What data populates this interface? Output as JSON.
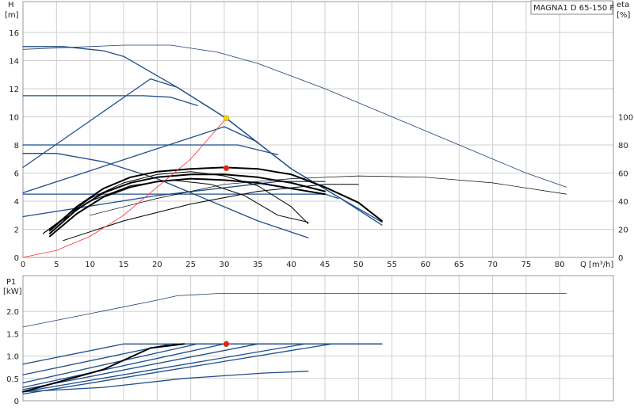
{
  "model_label": "MAGNA1 D 65-150 F",
  "chart_data": [
    {
      "type": "line",
      "name": "head",
      "ylabel": "H",
      "yunit": "[m]",
      "y2label": "eta",
      "y2unit": "[%]",
      "xlabel": "Q [m³/h]",
      "xlim": [
        0,
        88
      ],
      "ylim": [
        0,
        18.2
      ],
      "y2lim": [
        0,
        182
      ],
      "grid": true,
      "x_ticks": [
        0,
        5,
        10,
        15,
        20,
        25,
        30,
        35,
        40,
        45,
        50,
        55,
        60,
        65,
        70,
        75,
        80
      ],
      "y_ticks": [
        0,
        2,
        4,
        6,
        8,
        10,
        12,
        14,
        16
      ],
      "y2_ticks": [
        0,
        20,
        40,
        60,
        80,
        100
      ],
      "series": [
        {
          "style": "thin",
          "points": [
            [
              0,
              14.8
            ],
            [
              10,
              15.0
            ],
            [
              15,
              15.1
            ],
            [
              22,
              15.1
            ],
            [
              29,
              14.6
            ],
            [
              35,
              13.8
            ],
            [
              45,
              12.0
            ],
            [
              55,
              10.0
            ],
            [
              65,
              8.0
            ],
            [
              75,
              6.0
            ],
            [
              81,
              5.0
            ]
          ]
        },
        {
          "style": "medium",
          "points": [
            [
              0,
              6.4
            ],
            [
              19,
              12.7
            ],
            [
              23,
              12.1
            ],
            [
              30.3,
              9.9
            ],
            [
              40,
              6.3
            ],
            [
              47,
              4.3
            ],
            [
              53.5,
              2.5
            ]
          ]
        },
        {
          "style": "medium",
          "points": [
            [
              0,
              15.0
            ],
            [
              6,
              15.0
            ],
            [
              12,
              14.7
            ],
            [
              15,
              14.3
            ],
            [
              23,
              12.1
            ],
            [
              30.3,
              9.9
            ],
            [
              40,
              6.3
            ],
            [
              47,
              4.3
            ],
            [
              53.5,
              2.3
            ]
          ]
        },
        {
          "style": "medium",
          "points": [
            [
              0,
              11.5
            ],
            [
              18,
              11.5
            ],
            [
              22,
              11.4
            ],
            [
              26,
              10.8
            ]
          ]
        },
        {
          "style": "medium",
          "points": [
            [
              0,
              8.0
            ],
            [
              32,
              8.0
            ],
            [
              38,
              7.3
            ]
          ]
        },
        {
          "style": "medium",
          "points": [
            [
              0,
              4.5
            ],
            [
              45,
              4.5
            ],
            [
              47,
              4.2
            ]
          ]
        },
        {
          "style": "medium",
          "points": [
            [
              0,
              4.6
            ],
            [
              30,
              9.3
            ],
            [
              35,
              8.2
            ]
          ]
        },
        {
          "style": "medium",
          "points": [
            [
              0,
              2.9
            ],
            [
              20,
              4.4
            ],
            [
              38,
              5.4
            ],
            [
              45,
              5.4
            ]
          ]
        },
        {
          "style": "medium",
          "points": [
            [
              0,
              7.4
            ],
            [
              5,
              7.4
            ],
            [
              12,
              6.8
            ],
            [
              20,
              5.6
            ],
            [
              28,
              4.0
            ],
            [
              35,
              2.6
            ],
            [
              42.5,
              1.4
            ]
          ]
        },
        {
          "style": "thick",
          "points": [
            [
              4,
              1.9
            ],
            [
              8,
              3.6
            ],
            [
              12,
              4.9
            ],
            [
              16,
              5.7
            ],
            [
              20,
              6.1
            ],
            [
              25,
              6.3
            ],
            [
              30,
              6.4
            ],
            [
              35,
              6.3
            ],
            [
              40,
              5.9
            ],
            [
              45,
              5.0
            ],
            [
              50,
              3.9
            ],
            [
              53.5,
              2.6
            ]
          ]
        },
        {
          "style": "thick",
          "points": [
            [
              4,
              1.7
            ],
            [
              8,
              3.4
            ],
            [
              12,
              4.6
            ],
            [
              16,
              5.3
            ],
            [
              20,
              5.7
            ],
            [
              25,
              5.9
            ],
            [
              30,
              5.9
            ],
            [
              35,
              5.7
            ],
            [
              40,
              5.3
            ],
            [
              45,
              4.7
            ]
          ]
        },
        {
          "style": "thick",
          "points": [
            [
              4,
              1.5
            ],
            [
              8,
              3.1
            ],
            [
              12,
              4.3
            ],
            [
              16,
              5.0
            ],
            [
              20,
              5.4
            ],
            [
              25,
              5.6
            ],
            [
              30,
              5.5
            ],
            [
              35,
              5.3
            ],
            [
              40,
              4.9
            ],
            [
              45,
              4.5
            ]
          ]
        },
        {
          "style": "black",
          "points": [
            [
              3,
              1.7
            ],
            [
              10,
              4.2
            ],
            [
              15,
              5.3
            ],
            [
              20,
              5.9
            ],
            [
              25,
              6.1
            ],
            [
              30,
              5.8
            ],
            [
              35,
              5.1
            ],
            [
              40,
              3.6
            ],
            [
              42.5,
              2.4
            ]
          ]
        },
        {
          "style": "black",
          "points": [
            [
              3,
              1.7
            ],
            [
              10,
              4.0
            ],
            [
              16,
              5.1
            ],
            [
              22,
              5.5
            ],
            [
              28,
              5.2
            ],
            [
              33,
              4.4
            ],
            [
              38,
              3.0
            ],
            [
              42.5,
              2.5
            ]
          ]
        },
        {
          "style": "black",
          "points": [
            [
              6,
              1.2
            ],
            [
              15,
              2.6
            ],
            [
              25,
              3.8
            ],
            [
              35,
              4.7
            ],
            [
              45,
              5.2
            ],
            [
              50,
              5.2
            ]
          ]
        },
        {
          "style": "thin_black",
          "points": [
            [
              10,
              3.0
            ],
            [
              20,
              4.2
            ],
            [
              30,
              5.2
            ],
            [
              40,
              5.6
            ],
            [
              50,
              5.8
            ],
            [
              60,
              5.7
            ],
            [
              70,
              5.3
            ],
            [
              81,
              4.5
            ]
          ]
        },
        {
          "style": "red",
          "points": [
            [
              0,
              0
            ],
            [
              5,
              0.5
            ],
            [
              10,
              1.5
            ],
            [
              15,
              3.0
            ],
            [
              20,
              5.0
            ],
            [
              25,
              7.0
            ],
            [
              30.3,
              9.9
            ]
          ]
        }
      ],
      "markers": [
        {
          "x": 30.3,
          "y": 9.9,
          "color": "#f5d400"
        },
        {
          "x": 30.3,
          "y": 6.35,
          "color": "#e52020"
        }
      ]
    },
    {
      "type": "line",
      "name": "power",
      "ylabel": "P1",
      "yunit": "[kW]",
      "xlim": [
        0,
        88
      ],
      "ylim": [
        0,
        2.8
      ],
      "grid": true,
      "x_ticks": [
        0,
        5,
        10,
        15,
        20,
        25,
        30,
        35,
        40,
        45,
        50,
        55,
        60,
        65,
        70,
        75,
        80
      ],
      "y_ticks": [
        0,
        0.5,
        1.0,
        1.5,
        2.0
      ],
      "y_tick_labels": [
        "0",
        "0.5",
        "1.0",
        "1.5",
        "2.0"
      ],
      "series": [
        {
          "style": "thin",
          "points": [
            [
              0,
              1.65
            ],
            [
              10,
              1.95
            ],
            [
              20,
              2.25
            ],
            [
              23,
              2.35
            ],
            [
              29,
              2.4
            ],
            [
              40,
              2.4
            ],
            [
              60,
              2.4
            ],
            [
              81,
              2.4
            ]
          ]
        },
        {
          "style": "medium",
          "points": [
            [
              0,
              0.82
            ],
            [
              15,
              1.27
            ],
            [
              53.5,
              1.27
            ]
          ]
        },
        {
          "style": "medium",
          "points": [
            [
              0,
              0.58
            ],
            [
              22,
              1.27
            ],
            [
              53.5,
              1.27
            ]
          ]
        },
        {
          "style": "medium",
          "points": [
            [
              0,
              0.4
            ],
            [
              26,
              1.27
            ],
            [
              53.5,
              1.27
            ]
          ]
        },
        {
          "style": "medium",
          "points": [
            [
              0,
              0.3
            ],
            [
              30,
              1.27
            ],
            [
              53.5,
              1.27
            ]
          ]
        },
        {
          "style": "medium",
          "points": [
            [
              0,
              0.25
            ],
            [
              35,
              1.27
            ],
            [
              53.5,
              1.27
            ]
          ]
        },
        {
          "style": "medium",
          "points": [
            [
              0,
              0.2
            ],
            [
              42,
              1.27
            ],
            [
              53.5,
              1.27
            ]
          ]
        },
        {
          "style": "medium",
          "points": [
            [
              0,
              0.15
            ],
            [
              46,
              1.27
            ],
            [
              53.5,
              1.27
            ]
          ]
        },
        {
          "style": "medium",
          "points": [
            [
              0,
              0.2
            ],
            [
              12,
              0.3
            ],
            [
              24,
              0.5
            ],
            [
              36,
              0.62
            ],
            [
              42.5,
              0.66
            ]
          ]
        },
        {
          "style": "thick",
          "points": [
            [
              0,
              0.2
            ],
            [
              12,
              0.7
            ],
            [
              19,
              1.18
            ],
            [
              24,
              1.27
            ]
          ]
        }
      ],
      "markers": [
        {
          "x": 30.3,
          "y": 1.27,
          "color": "#e52020"
        }
      ]
    }
  ]
}
